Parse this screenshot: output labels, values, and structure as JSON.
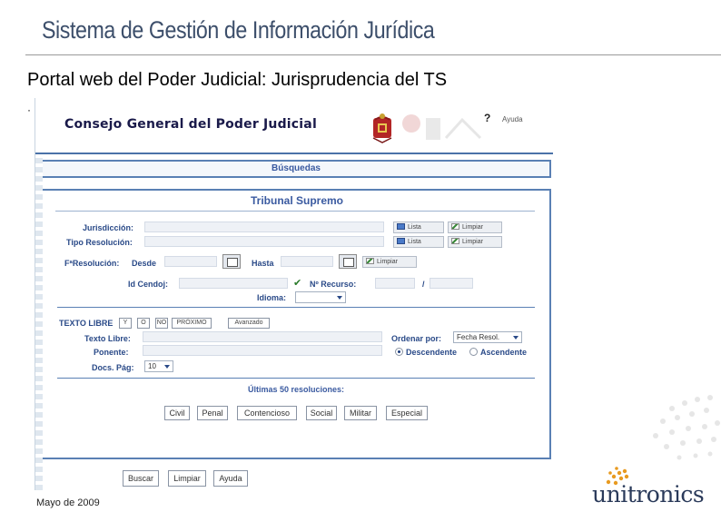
{
  "slide": {
    "title": "Sistema de Gestión de Información Jurídica",
    "subtitle": "Portal web del Poder Judicial: Jurisprudencia del TS",
    "bullet": "·",
    "footer_date": "Mayo de 2009",
    "logo_text": "unitronics"
  },
  "colors": {
    "title": "#3d4f6b",
    "panel_border": "#5a80b4",
    "label": "#2a4a88",
    "heading": "#3a5aa0"
  },
  "app": {
    "header_title": "Consejo General del Poder Judicial",
    "help_icon": "?",
    "help_label": "Ayuda",
    "crest_icon": "coat-of-arms-icon",
    "nav_bar": "Búsquedas",
    "panel_title": "Tribunal Supremo",
    "form": {
      "jurisdiccion_label": "Jurisdicción:",
      "tipo_resolucion_label": "Tipo Resolución:",
      "lista_label": "Lista",
      "limpiar_label": "Limpiar",
      "fresolucion_label": "FªResolución:",
      "desde_label": "Desde",
      "hasta_label": "Hasta",
      "id_cendoj_label": "Id Cendoj:",
      "n_recurso_label": "Nº Recurso:",
      "recurso_separator": "/",
      "idioma_label": "Idioma:",
      "texto_libre_section": "TEXTO LIBRE",
      "op_y": "Y",
      "op_o": "O",
      "op_no": "NO",
      "op_proximo": "PRÓXIMO",
      "op_avanzado": "Avanzado",
      "texto_libre_label": "Texto Libre:",
      "ponente_label": "Ponente:",
      "docs_pag_label": "Docs. Pág:",
      "docs_pag_value": "10",
      "ordenar_label": "Ordenar por:",
      "ordenar_value": "Fecha Resol.",
      "descendente_label": "Descendente",
      "ascendente_label": "Ascendente",
      "ultimas_label": "Últimas 50 resoluciones:"
    },
    "categories": [
      "Civil",
      "Penal",
      "Contencioso",
      "Social",
      "Militar",
      "Especial"
    ],
    "bottom_buttons": {
      "buscar": "Buscar",
      "limpiar": "Limpiar",
      "ayuda": "Ayuda"
    }
  }
}
